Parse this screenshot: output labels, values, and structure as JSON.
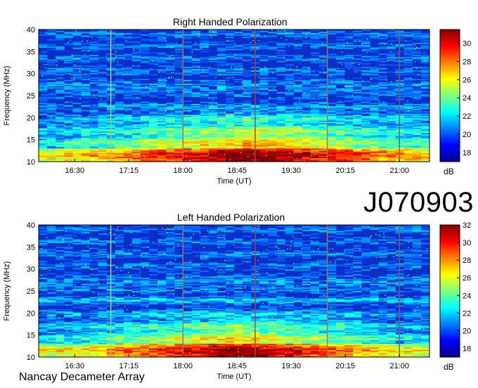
{
  "page": {
    "observation_id": "J070903",
    "instrument": "Nancay Decameter Array"
  },
  "chart_data": [
    {
      "type": "heatmap",
      "title": "Right Handed Polarization",
      "xlabel": "Time (UT)",
      "ylabel": "Frequency (MHz)",
      "x_tick_labels": [
        "16:30",
        "17:15",
        "18:00",
        "18:45",
        "19:30",
        "20:15",
        "21:00"
      ],
      "y_ticks": [
        10,
        15,
        20,
        25,
        30,
        35,
        40
      ],
      "ylim": [
        10,
        40
      ],
      "colorbar": {
        "label": "dB",
        "range": [
          17,
          31.5
        ],
        "ticks": [
          18,
          20,
          22,
          24,
          26,
          28,
          30
        ]
      },
      "colormap": "jet",
      "vertical_markers": [
        "17:00",
        "18:00",
        "19:00",
        "20:00",
        "21:00"
      ],
      "marker_colors": [
        "#c8c060",
        "#b07050",
        "#b04040",
        "#b07050",
        "#a05050"
      ],
      "intense_emission": {
        "freq_range_mhz": [
          10,
          24
        ],
        "peak_time": "18:00-20:00"
      }
    },
    {
      "type": "heatmap",
      "title": "Left Handed Polarization",
      "xlabel": "Time (UT)",
      "ylabel": "Frequency (MHz)",
      "x_tick_labels": [
        "16:30",
        "17:15",
        "18:00",
        "18:45",
        "19:30",
        "20:15",
        "21:00"
      ],
      "y_ticks": [
        10,
        15,
        20,
        25,
        30,
        35,
        40
      ],
      "ylim": [
        10,
        40
      ],
      "colorbar": {
        "label": "dB",
        "range": [
          17,
          32
        ],
        "ticks": [
          18,
          20,
          22,
          24,
          26,
          28,
          30,
          32
        ]
      },
      "colormap": "jet",
      "vertical_markers": [
        "17:00",
        "18:00",
        "19:00",
        "20:00",
        "21:00"
      ],
      "marker_colors": [
        "#c8c060",
        "#b07050",
        "#b04040",
        "#b07050",
        "#a05050"
      ],
      "intense_emission": {
        "freq_range_mhz": [
          10,
          22
        ],
        "peak_time": "18:00-19:30"
      }
    }
  ]
}
